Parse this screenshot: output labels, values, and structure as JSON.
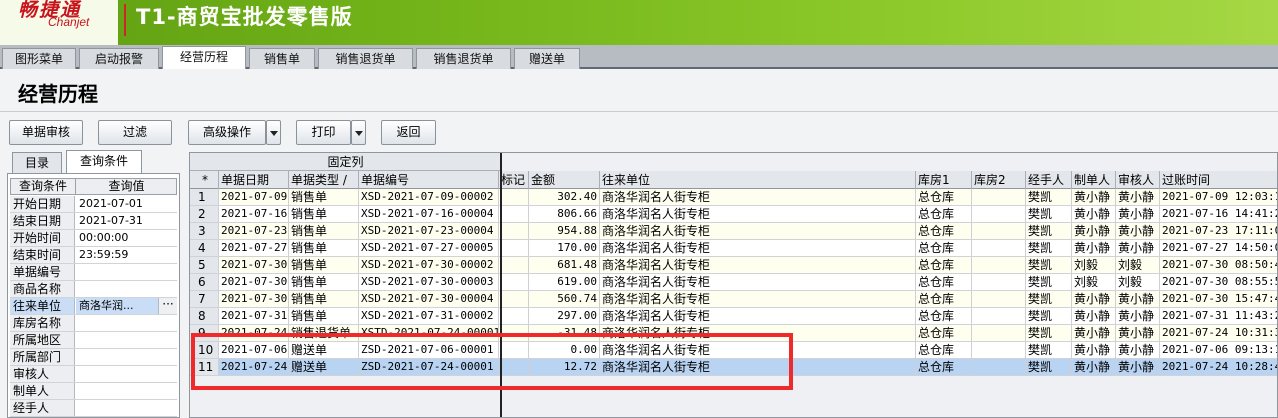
{
  "app": {
    "logo_cn": "畅捷通",
    "logo_en": "Chanjet",
    "product_title": "T1-商贸宝批发零售版"
  },
  "tabs": [
    "图形菜单",
    "启动报警",
    "经营历程",
    "销售单",
    "销售退货单",
    "销售退货单",
    "赠送单"
  ],
  "active_tab": "经营历程",
  "page_title": "经营历程",
  "toolbar": {
    "review": "单据审核",
    "filter": "过滤",
    "advanced": "高级操作",
    "print": "打印",
    "back": "返回"
  },
  "left": {
    "tabs": [
      "目录",
      "查询条件"
    ],
    "head": [
      "查询条件",
      "查询值"
    ],
    "rows": [
      {
        "k": "开始日期",
        "v": "2021-07-01"
      },
      {
        "k": "结束日期",
        "v": "2021-07-31"
      },
      {
        "k": "开始时间",
        "v": "00:00:00"
      },
      {
        "k": "结束时间",
        "v": "23:59:59"
      },
      {
        "k": "单据编号",
        "v": ""
      },
      {
        "k": "商品名称",
        "v": ""
      },
      {
        "k": "往来单位",
        "v": "商洛华润..."
      },
      {
        "k": "库房名称",
        "v": ""
      },
      {
        "k": "所属地区",
        "v": ""
      },
      {
        "k": "所属部门",
        "v": ""
      },
      {
        "k": "审核人",
        "v": ""
      },
      {
        "k": "制单人",
        "v": ""
      },
      {
        "k": "经手人",
        "v": ""
      }
    ],
    "ellipsis": "···"
  },
  "grid": {
    "fixed_label": "固定列",
    "row_marker": "*",
    "columns": [
      "单据日期",
      "单据类型 /",
      "单据编号",
      "标记",
      "金额",
      "往来单位",
      "库房1",
      "库房2",
      "经手人",
      "制单人",
      "审核人",
      "过账时间"
    ],
    "rows": [
      [
        "1",
        "2021-07-09",
        "销售单",
        "XSD-2021-07-09-00002",
        "",
        "302.40",
        "商洛华润名人街专柜",
        "总仓库",
        "",
        "樊凯",
        "黄小静",
        "黄小静",
        "2021-07-09 12:03:15"
      ],
      [
        "2",
        "2021-07-16",
        "销售单",
        "XSD-2021-07-16-00004",
        "",
        "806.66",
        "商洛华润名人街专柜",
        "总仓库",
        "",
        "樊凯",
        "黄小静",
        "黄小静",
        "2021-07-16 14:41:25"
      ],
      [
        "3",
        "2021-07-23",
        "销售单",
        "XSD-2021-07-23-00004",
        "",
        "954.88",
        "商洛华润名人街专柜",
        "总仓库",
        "",
        "樊凯",
        "黄小静",
        "黄小静",
        "2021-07-23 17:11:03"
      ],
      [
        "4",
        "2021-07-27",
        "销售单",
        "XSD-2021-07-27-00005",
        "",
        "170.00",
        "商洛华润名人街专柜",
        "总仓库",
        "",
        "樊凯",
        "黄小静",
        "黄小静",
        "2021-07-27 14:50:01"
      ],
      [
        "5",
        "2021-07-30",
        "销售单",
        "XSD-2021-07-30-00002",
        "",
        "681.48",
        "商洛华润名人街专柜",
        "总仓库",
        "",
        "樊凯",
        "刘毅",
        "刘毅",
        "2021-07-30 08:50:41"
      ],
      [
        "6",
        "2021-07-30",
        "销售单",
        "XSD-2021-07-30-00003",
        "",
        "619.00",
        "商洛华润名人街专柜",
        "总仓库",
        "",
        "樊凯",
        "刘毅",
        "刘毅",
        "2021-07-30 08:55:55"
      ],
      [
        "7",
        "2021-07-30",
        "销售单",
        "XSD-2021-07-30-00004",
        "",
        "560.74",
        "商洛华润名人街专柜",
        "总仓库",
        "",
        "樊凯",
        "黄小静",
        "黄小静",
        "2021-07-30 15:47:43"
      ],
      [
        "8",
        "2021-07-31",
        "销售单",
        "XSD-2021-07-31-00002",
        "",
        "297.00",
        "商洛华润名人街专柜",
        "总仓库",
        "",
        "樊凯",
        "黄小静",
        "黄小静",
        "2021-07-31 11:43:29"
      ],
      [
        "9",
        "2021-07-24",
        "销售退货单",
        "XSTD-2021-07-24-00001",
        "",
        "-31.48",
        "商洛华润名人街专柜",
        "总仓库",
        "",
        "樊凯",
        "黄小静",
        "黄小静",
        "2021-07-24 10:31:38"
      ],
      [
        "10",
        "2021-07-06",
        "赠送单",
        "ZSD-2021-07-06-00001",
        "",
        "0.00",
        "商洛华润名人街专柜",
        "总仓库",
        "",
        "樊凯",
        "黄小静",
        "黄小静",
        "2021-07-06 09:13:16"
      ],
      [
        "11",
        "2021-07-24",
        "赠送单",
        "ZSD-2021-07-24-00001",
        "",
        "12.72",
        "商洛华润名人街专柜",
        "总仓库",
        "",
        "樊凯",
        "黄小静",
        "黄小静",
        "2021-07-24 10:28:44"
      ]
    ],
    "selected_row": 11
  },
  "colors": {
    "banner": "#74b51a",
    "highlight_box": "#ee2a2a",
    "selected_row": "#b9d3f3"
  }
}
